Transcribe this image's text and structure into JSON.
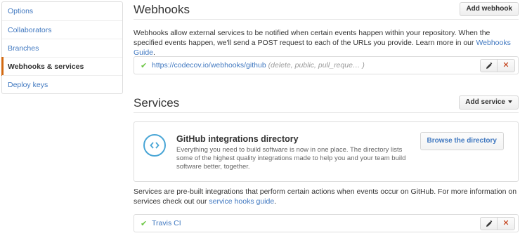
{
  "sidebar": {
    "items": [
      {
        "label": "Options"
      },
      {
        "label": "Collaborators"
      },
      {
        "label": "Branches"
      },
      {
        "label": "Webhooks & services"
      },
      {
        "label": "Deploy keys"
      }
    ]
  },
  "webhooks": {
    "title": "Webhooks",
    "add_label": "Add webhook",
    "description_pre": "Webhooks allow external services to be notified when certain events happen within your repository. When the specified events happen, we'll send a POST request to each of the URLs you provide. Learn more in our ",
    "guide_link": "Webhooks Guide",
    "description_post": ".",
    "hook": {
      "check": "✔",
      "url": "https://codecov.io/webhooks/github",
      "events": "(delete, public, pull_reque… )"
    }
  },
  "services": {
    "title": "Services",
    "add_label": "Add service",
    "integrations": {
      "title": "GitHub integrations directory",
      "description": "Everything you need to build software is now in one place. The directory lists some of the highest quality integrations made to help you and your team build software better, together.",
      "browse_label": "Browse the directory"
    },
    "description_pre": "Services are pre-built integrations that perform certain actions when events occur on GitHub. For more information on services check out our ",
    "guide_link": "service hooks guide",
    "description_post": ".",
    "service": {
      "check": "✔",
      "name": "Travis CI"
    }
  },
  "colors": {
    "link": "#4078c0",
    "selected_accent": "#d26911",
    "success": "#6cc644",
    "danger": "#bd2c00",
    "integration_icon": "#4aa6d6"
  }
}
